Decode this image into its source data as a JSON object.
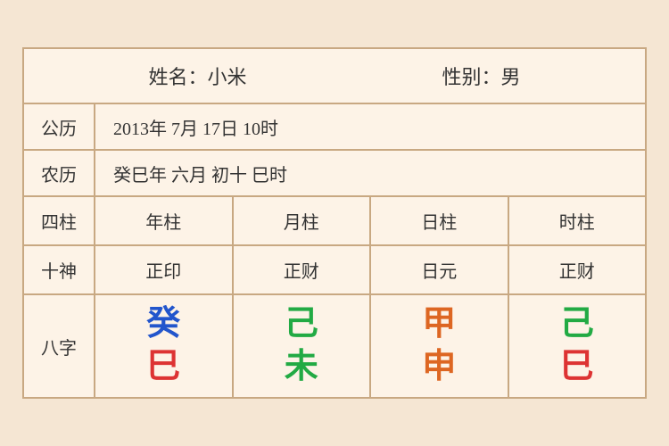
{
  "header": {
    "name_label": "姓名：小米",
    "gender_label": "性别：男"
  },
  "solar": {
    "label": "公历",
    "value": "2013年 7月 17日 10时"
  },
  "lunar": {
    "label": "农历",
    "value": "癸巳年 六月 初十 巳时"
  },
  "grid_header": {
    "label": "四柱",
    "cols": [
      "年柱",
      "月柱",
      "日柱",
      "时柱"
    ]
  },
  "shishen": {
    "label": "十神",
    "cols": [
      "正印",
      "正财",
      "日元",
      "正财"
    ]
  },
  "bazi": {
    "label": "八字",
    "cols": [
      {
        "top": "癸",
        "top_color": "color-blue",
        "bottom": "巳",
        "bottom_color": "color-red"
      },
      {
        "top": "己",
        "top_color": "color-green",
        "bottom": "未",
        "bottom_color": "color-green"
      },
      {
        "top": "甲",
        "top_color": "color-orange",
        "bottom": "申",
        "bottom_color": "color-orange2"
      },
      {
        "top": "己",
        "top_color": "color-green2",
        "bottom": "巳",
        "bottom_color": "color-red3"
      }
    ]
  }
}
